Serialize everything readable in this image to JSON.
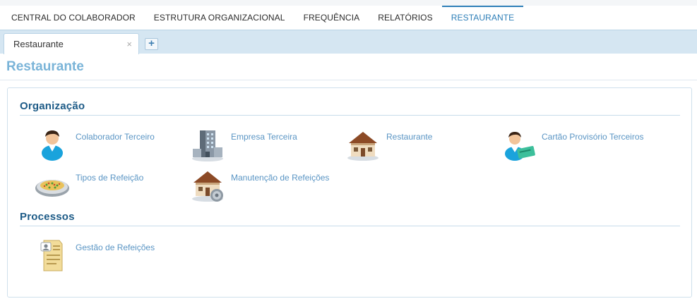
{
  "topnav": {
    "items": [
      {
        "label": "CENTRAL DO COLABORADOR"
      },
      {
        "label": "ESTRUTURA ORGANIZACIONAL"
      },
      {
        "label": "FREQUÊNCIA"
      },
      {
        "label": "RELATÓRIOS"
      },
      {
        "label": "RESTAURANTE"
      }
    ],
    "active": "RESTAURANTE",
    "accent": "#2e7fb8"
  },
  "tabs": {
    "open": [
      {
        "label": "Restaurante",
        "close": "×"
      }
    ],
    "add_label": "+"
  },
  "page": {
    "title": "Restaurante"
  },
  "sections": [
    {
      "title": "Organização",
      "entries": [
        {
          "label": "Colaborador Terceiro",
          "icon": "person-icon"
        },
        {
          "label": "Empresa Terceira",
          "icon": "building-icon"
        },
        {
          "label": "Restaurante",
          "icon": "house-icon"
        },
        {
          "label": "Cartão Provisório Terceiros",
          "icon": "person-card-icon"
        },
        {
          "label": "Tipos de Refeição",
          "icon": "food-plate-icon"
        },
        {
          "label": "Manutenção de Refeições",
          "icon": "house-gear-icon"
        }
      ]
    },
    {
      "title": "Processos",
      "entries": [
        {
          "label": "Gestão de Refeições",
          "icon": "document-icon"
        }
      ]
    }
  ]
}
